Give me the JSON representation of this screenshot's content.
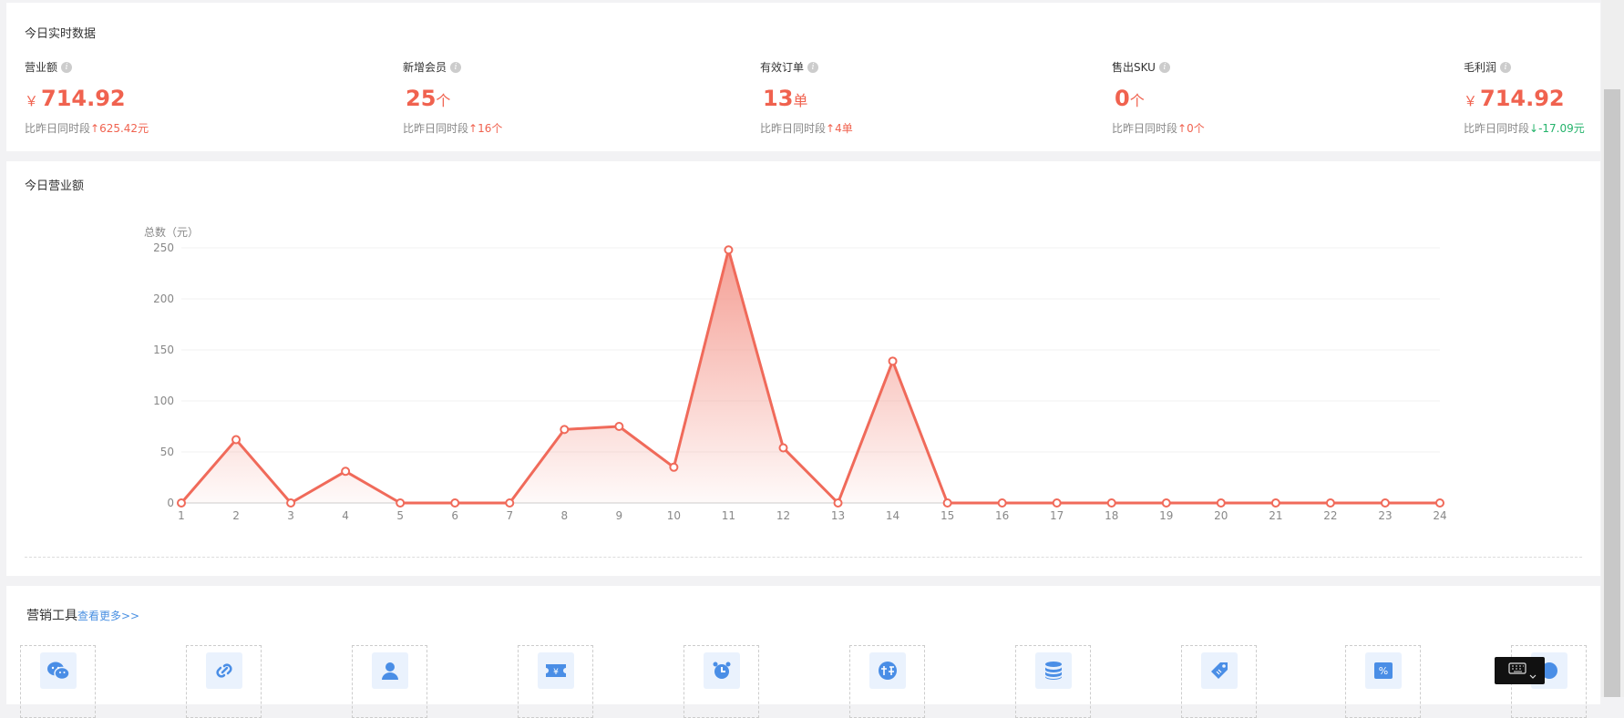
{
  "realtime": {
    "title": "今日实时数据",
    "stats": [
      {
        "label": "营业额",
        "currency": "￥",
        "value": "714.92",
        "unit": "",
        "compare_prefix": "比昨日同时段",
        "delta_arrow": "↑",
        "delta": "625.42元",
        "direction": "up"
      },
      {
        "label": "新增会员",
        "currency": "",
        "value": "25",
        "unit": "个",
        "compare_prefix": "比昨日同时段",
        "delta_arrow": "↑",
        "delta": "16个",
        "direction": "up"
      },
      {
        "label": "有效订单",
        "currency": "",
        "value": "13",
        "unit": "单",
        "compare_prefix": "比昨日同时段",
        "delta_arrow": "↑",
        "delta": "4单",
        "direction": "up"
      },
      {
        "label": "售出SKU",
        "currency": "",
        "value": "0",
        "unit": "个",
        "compare_prefix": "比昨日同时段",
        "delta_arrow": "↑",
        "delta": "0个",
        "direction": "up"
      },
      {
        "label": "毛利润",
        "currency": "￥",
        "value": "714.92",
        "unit": "",
        "compare_prefix": "比昨日同时段",
        "delta_arrow": "↓",
        "delta": "-17.09元",
        "direction": "down"
      }
    ],
    "info_icon_glyph": "i"
  },
  "revenue_chart": {
    "title": "今日营业额"
  },
  "chart_data": {
    "type": "area",
    "title": "",
    "ylabel": "总数（元）",
    "xlabel": "",
    "x": [
      "1",
      "2",
      "3",
      "4",
      "5",
      "6",
      "7",
      "8",
      "9",
      "10",
      "11",
      "12",
      "13",
      "14",
      "15",
      "16",
      "17",
      "18",
      "19",
      "20",
      "21",
      "22",
      "23",
      "24"
    ],
    "series": [
      {
        "values": [
          0,
          62,
          0,
          31,
          0,
          0,
          0,
          72,
          75,
          35,
          248,
          54,
          0,
          139,
          0,
          0,
          0,
          0,
          0,
          0,
          0,
          0,
          0,
          0
        ]
      }
    ],
    "ylim": [
      0,
      250
    ],
    "yticks": [
      0,
      50,
      100,
      150,
      200,
      250
    ],
    "grid": true,
    "line_color": "#f06a5a",
    "fill_color": "#f49a8f"
  },
  "tools": {
    "title": "营销工具",
    "more_link": "查看更多>>",
    "icons": [
      "wechat-icon",
      "link-icon",
      "member-icon",
      "coupon-icon",
      "alarm-clock-icon",
      "group-buy-icon",
      "points-database-icon",
      "tag-icon",
      "discount-icon",
      "extra-tool-icon"
    ]
  },
  "colors": {
    "accent": "#f0624f",
    "positive": "#f0624f",
    "negative": "#24b36b",
    "link": "#4a90e2",
    "icon_blue": "#4a8ee6"
  }
}
